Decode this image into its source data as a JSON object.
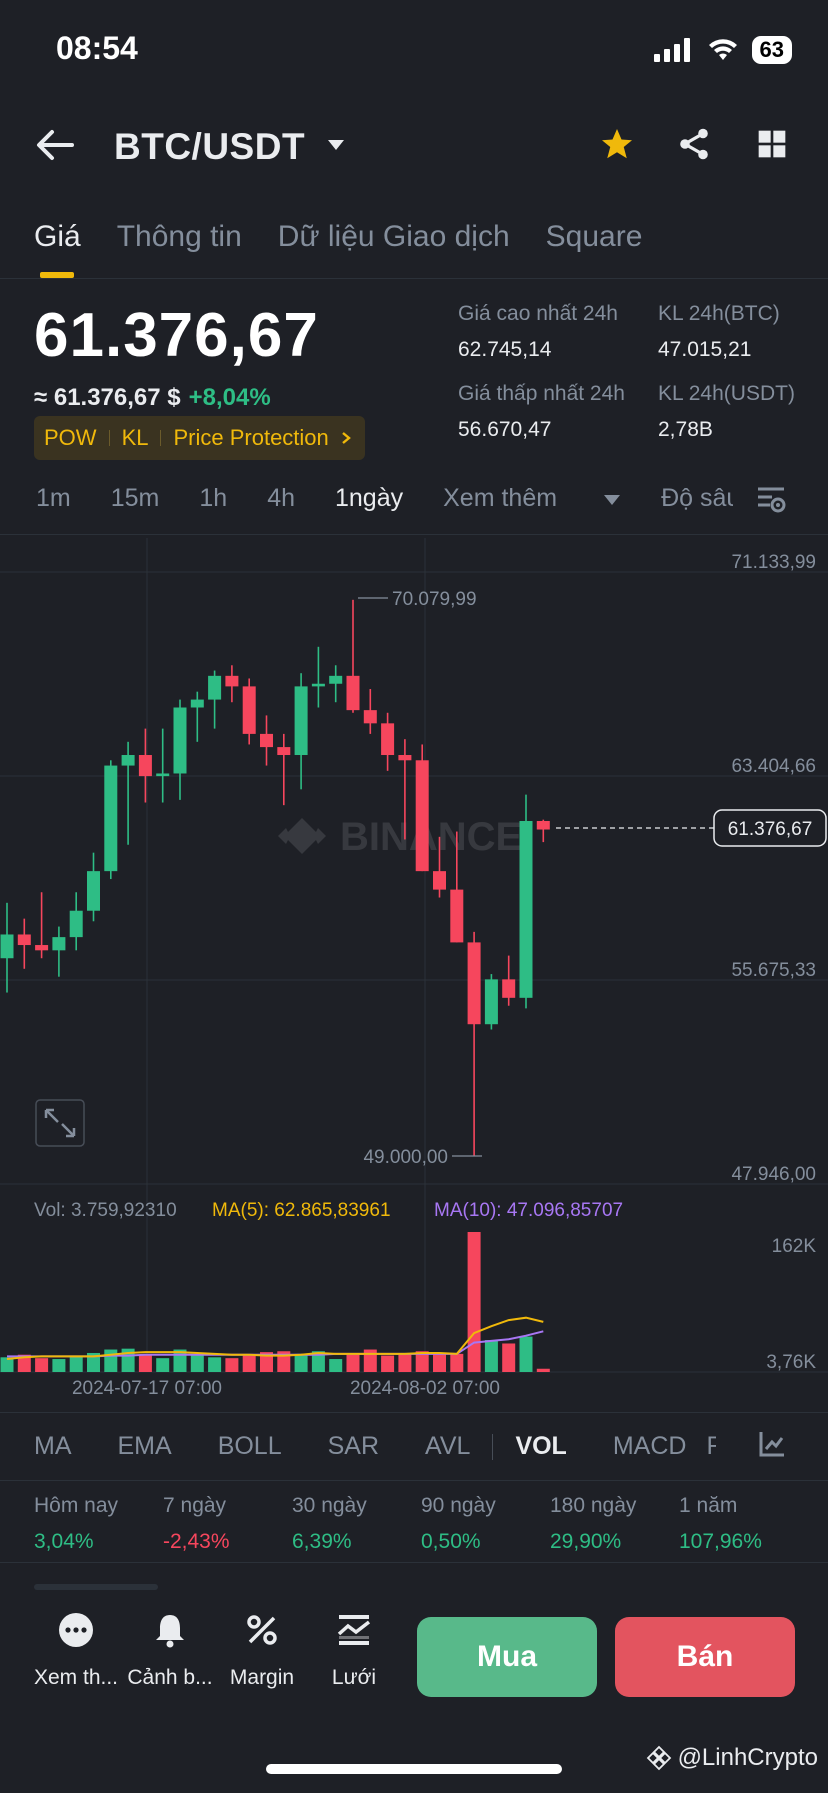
{
  "status_bar": {
    "time": "08:54",
    "battery": "63"
  },
  "header": {
    "pair": "BTC/USDT"
  },
  "tabs": [
    {
      "label": "Giá",
      "active": true
    },
    {
      "label": "Thông tin",
      "active": false
    },
    {
      "label": "Dữ liệu Giao dịch",
      "active": false
    },
    {
      "label": "Square",
      "active": false
    }
  ],
  "price": {
    "last": "61.376,67",
    "approx": "≈ 61.376,67 $",
    "change_pct": "+8,04%",
    "tags": [
      "POW",
      "KL",
      "Price Protection"
    ]
  },
  "stats": {
    "high_label": "Giá cao nhất 24h",
    "high": "62.745,14",
    "low_label": "Giá thấp nhất 24h",
    "low": "56.670,47",
    "vol_btc_label": "KL 24h(BTC)",
    "vol_btc": "47.015,21",
    "vol_usdt_label": "KL 24h(USDT)",
    "vol_usdt": "2,78B"
  },
  "intervals": [
    "1m",
    "15m",
    "1h",
    "4h",
    "1ngày"
  ],
  "selected_interval": "1ngày",
  "intervals_more": "Xem thêm",
  "intervals_depth": "Độ sâu",
  "chart_axis": {
    "price_ticks": [
      "71.133,99",
      "63.404,66",
      "55.675,33",
      "47.946,00"
    ],
    "current_price": "61.376,67",
    "max_label": "70.079,99",
    "min_label": "49.000,00",
    "watermark": "BINANCE",
    "vol_ticks": [
      "162K",
      "3,76K"
    ],
    "dates": [
      "2024-07-17 07:00",
      "2024-08-02 07:00"
    ]
  },
  "volume_legend": {
    "vol": "Vol: 3.759,92310",
    "ma5": "MA(5): 62.865,83961",
    "ma10": "MA(10): 47.096,85707"
  },
  "chart_data": {
    "type": "candlestick",
    "ylim": [
      47946,
      71134
    ],
    "candles": [
      {
        "o": 56500,
        "h": 58600,
        "l": 55200,
        "c": 57400
      },
      {
        "o": 57400,
        "h": 58000,
        "l": 56100,
        "c": 57000
      },
      {
        "o": 57000,
        "h": 59000,
        "l": 56500,
        "c": 56800
      },
      {
        "o": 56800,
        "h": 57700,
        "l": 55800,
        "c": 57300
      },
      {
        "o": 57300,
        "h": 59000,
        "l": 56800,
        "c": 58300
      },
      {
        "o": 58300,
        "h": 60500,
        "l": 57900,
        "c": 59800
      },
      {
        "o": 59800,
        "h": 64000,
        "l": 59500,
        "c": 63800
      },
      {
        "o": 63800,
        "h": 64700,
        "l": 60800,
        "c": 64200
      },
      {
        "o": 64200,
        "h": 65200,
        "l": 62400,
        "c": 63400
      },
      {
        "o": 63400,
        "h": 65200,
        "l": 62400,
        "c": 63500
      },
      {
        "o": 63500,
        "h": 66300,
        "l": 62500,
        "c": 66000
      },
      {
        "o": 66000,
        "h": 66600,
        "l": 64700,
        "c": 66300
      },
      {
        "o": 66300,
        "h": 67400,
        "l": 65200,
        "c": 67200
      },
      {
        "o": 67200,
        "h": 67600,
        "l": 66200,
        "c": 66800
      },
      {
        "o": 66800,
        "h": 67100,
        "l": 64600,
        "c": 65000
      },
      {
        "o": 65000,
        "h": 65700,
        "l": 63800,
        "c": 64500
      },
      {
        "o": 64500,
        "h": 65000,
        "l": 62300,
        "c": 64200
      },
      {
        "o": 64200,
        "h": 67300,
        "l": 62900,
        "c": 66800
      },
      {
        "o": 66800,
        "h": 68300,
        "l": 66000,
        "c": 66900
      },
      {
        "o": 66900,
        "h": 67600,
        "l": 66200,
        "c": 67200
      },
      {
        "o": 67200,
        "h": 70080,
        "l": 65800,
        "c": 65900
      },
      {
        "o": 65900,
        "h": 66700,
        "l": 65000,
        "c": 65400
      },
      {
        "o": 65400,
        "h": 65800,
        "l": 63600,
        "c": 64200
      },
      {
        "o": 64200,
        "h": 64800,
        "l": 61000,
        "c": 64000
      },
      {
        "o": 64000,
        "h": 64600,
        "l": 59800,
        "c": 59800
      },
      {
        "o": 59800,
        "h": 61100,
        "l": 58800,
        "c": 59100
      },
      {
        "o": 59100,
        "h": 61300,
        "l": 57100,
        "c": 57100
      },
      {
        "o": 57100,
        "h": 57500,
        "l": 49000,
        "c": 54000
      },
      {
        "o": 54000,
        "h": 55900,
        "l": 53800,
        "c": 55700
      },
      {
        "o": 55700,
        "h": 56600,
        "l": 54700,
        "c": 55000
      },
      {
        "o": 55000,
        "h": 62700,
        "l": 54600,
        "c": 61700
      },
      {
        "o": 61700,
        "h": 61750,
        "l": 60900,
        "c": 61377
      }
    ],
    "volume": [
      17,
      20,
      16,
      15,
      18,
      22,
      26,
      27,
      20,
      16,
      26,
      20,
      17,
      16,
      19,
      23,
      24,
      21,
      24,
      15,
      20,
      26,
      19,
      21,
      24,
      22,
      21,
      162,
      37,
      33,
      41,
      3.76
    ],
    "volume_ma5": [
      15,
      17,
      18,
      18,
      18,
      18,
      20,
      22,
      23,
      23,
      23,
      22,
      21,
      20,
      20,
      19,
      19,
      20,
      22,
      21,
      21,
      21,
      21,
      21,
      22,
      22,
      21,
      45,
      53,
      60,
      62.87,
      58
    ],
    "volume_ma10": [
      18,
      18,
      18,
      18,
      18,
      18,
      19,
      19,
      20,
      20,
      20,
      20,
      20,
      20,
      20,
      20,
      20,
      20,
      20,
      21,
      21,
      21,
      21,
      21,
      21,
      21,
      21,
      34,
      36,
      38,
      42,
      47.1
    ]
  },
  "indicators": [
    "MA",
    "EMA",
    "BOLL",
    "SAR",
    "AVL",
    "VOL",
    "MACD",
    "R"
  ],
  "selected_indicator": "VOL",
  "performance": [
    {
      "label": "Hôm nay",
      "value": "3,04%",
      "positive": true
    },
    {
      "label": "7 ngày",
      "value": "-2,43%",
      "positive": false
    },
    {
      "label": "30 ngày",
      "value": "6,39%",
      "positive": true
    },
    {
      "label": "90 ngày",
      "value": "0,50%",
      "positive": true
    },
    {
      "label": "180 ngày",
      "value": "29,90%",
      "positive": true
    },
    {
      "label": "1 năm",
      "value": "107,96%",
      "positive": true
    }
  ],
  "bottom_nav": [
    {
      "label": "Xem th...",
      "icon": "more-dots-icon"
    },
    {
      "label": "Cảnh b...",
      "icon": "bell-icon"
    },
    {
      "label": "Margin",
      "icon": "percent-icon"
    },
    {
      "label": "Lưới",
      "icon": "grid-bot-icon"
    }
  ],
  "buy_label": "Mua",
  "sell_label": "Bán",
  "watermark_text": "@LinhCrypto",
  "colors": {
    "up": "#2ebd85",
    "down": "#f6465d",
    "accent": "#f0b90b",
    "bg": "#1e2026",
    "ma5": "#f0b90b",
    "ma10": "#a877f4"
  }
}
